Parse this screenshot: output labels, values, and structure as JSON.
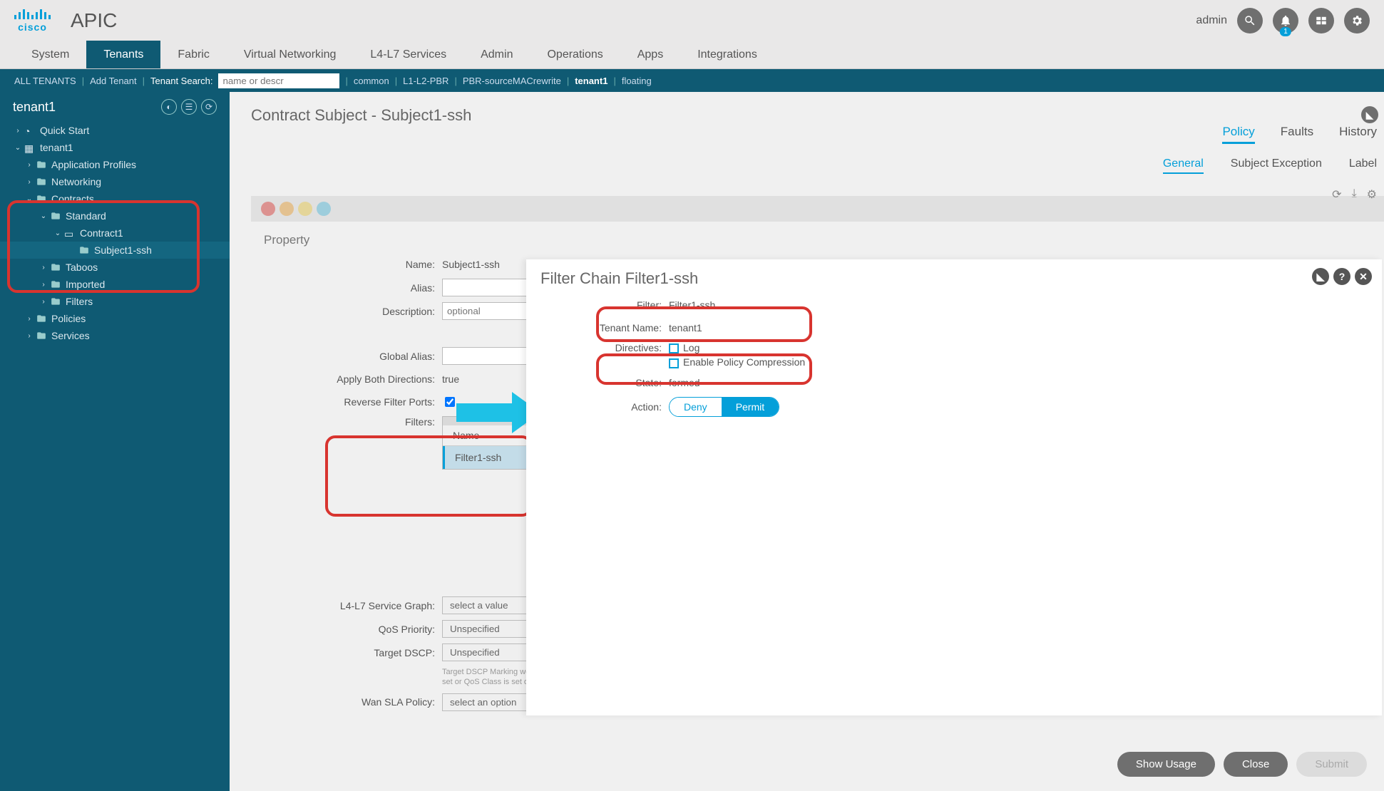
{
  "header": {
    "app_title": "APIC",
    "logo_text": "cisco",
    "user": "admin",
    "alert_badge": "1"
  },
  "nav": {
    "tabs": [
      "System",
      "Tenants",
      "Fabric",
      "Virtual Networking",
      "L4-L7 Services",
      "Admin",
      "Operations",
      "Apps",
      "Integrations"
    ],
    "active": "Tenants"
  },
  "subbar": {
    "all_tenants": "ALL TENANTS",
    "add_tenant": "Add Tenant",
    "search_label": "Tenant Search:",
    "search_placeholder": "name or descr",
    "links": [
      "common",
      "L1-L2-PBR",
      "PBR-sourceMACrewrite",
      "tenant1",
      "floating"
    ],
    "active": "tenant1"
  },
  "sidebar": {
    "title": "tenant1",
    "items": [
      {
        "label": "Quick Start",
        "level": 0,
        "caret": ">",
        "icon": "quickstart"
      },
      {
        "label": "tenant1",
        "level": 0,
        "caret": "v",
        "icon": "tenant"
      },
      {
        "label": "Application Profiles",
        "level": 1,
        "caret": ">",
        "icon": "folder"
      },
      {
        "label": "Networking",
        "level": 1,
        "caret": ">",
        "icon": "folder"
      },
      {
        "label": "Contracts",
        "level": 1,
        "caret": "v",
        "icon": "folder"
      },
      {
        "label": "Standard",
        "level": 2,
        "caret": "v",
        "icon": "folder"
      },
      {
        "label": "Contract1",
        "level": 3,
        "caret": "v",
        "icon": "contract"
      },
      {
        "label": "Subject1-ssh",
        "level": 4,
        "caret": "",
        "icon": "folder",
        "selected": true
      },
      {
        "label": "Taboos",
        "level": 2,
        "caret": ">",
        "icon": "folder"
      },
      {
        "label": "Imported",
        "level": 2,
        "caret": ">",
        "icon": "folder"
      },
      {
        "label": "Filters",
        "level": 2,
        "caret": ">",
        "icon": "folder"
      },
      {
        "label": "Policies",
        "level": 1,
        "caret": ">",
        "icon": "folder"
      },
      {
        "label": "Services",
        "level": 1,
        "caret": ">",
        "icon": "folder"
      }
    ]
  },
  "main": {
    "title": "Contract Subject - Subject1-ssh",
    "tabs": [
      "Policy",
      "Faults",
      "History"
    ],
    "tab_active": "Policy",
    "subtabs": [
      "General",
      "Subject Exception",
      "Label"
    ],
    "subtab_active": "General",
    "property_heading": "Property",
    "fields": {
      "name_label": "Name:",
      "name_value": "Subject1-ssh",
      "alias_label": "Alias:",
      "alias_value": "",
      "description_label": "Description:",
      "description_placeholder": "optional",
      "global_alias_label": "Global Alias:",
      "global_alias_value": "",
      "apply_both_label": "Apply Both Directions:",
      "apply_both_value": "true",
      "reverse_label": "Reverse Filter Ports:",
      "filters_label": "Filters:",
      "filters_col": "Name",
      "filters_row": "Filter1-ssh",
      "service_graph_label": "L4-L7 Service Graph:",
      "service_graph_value": "select a value",
      "qos_label": "QoS Priority:",
      "qos_value": "Unspecified",
      "dscp_label": "Target DSCP:",
      "dscp_value": "Unspecified",
      "dscp_hint": "Target DSCP Marking works only if the Contract is set or QoS Class is set on the Contract",
      "wan_label": "Wan SLA Policy:",
      "wan_value": "select an option"
    },
    "footer": {
      "show_usage": "Show Usage",
      "close": "Close",
      "submit": "Submit"
    }
  },
  "panel": {
    "title": "Filter Chain Filter1-ssh",
    "filter_label": "Filter:",
    "filter_value": "Filter1-ssh",
    "tenant_label": "Tenant Name:",
    "tenant_value": "tenant1",
    "directives_label": "Directives:",
    "directive_log": "Log",
    "directive_compress": "Enable Policy Compression",
    "state_label": "State:",
    "state_value": "formed",
    "action_label": "Action:",
    "action_deny": "Deny",
    "action_permit": "Permit"
  }
}
